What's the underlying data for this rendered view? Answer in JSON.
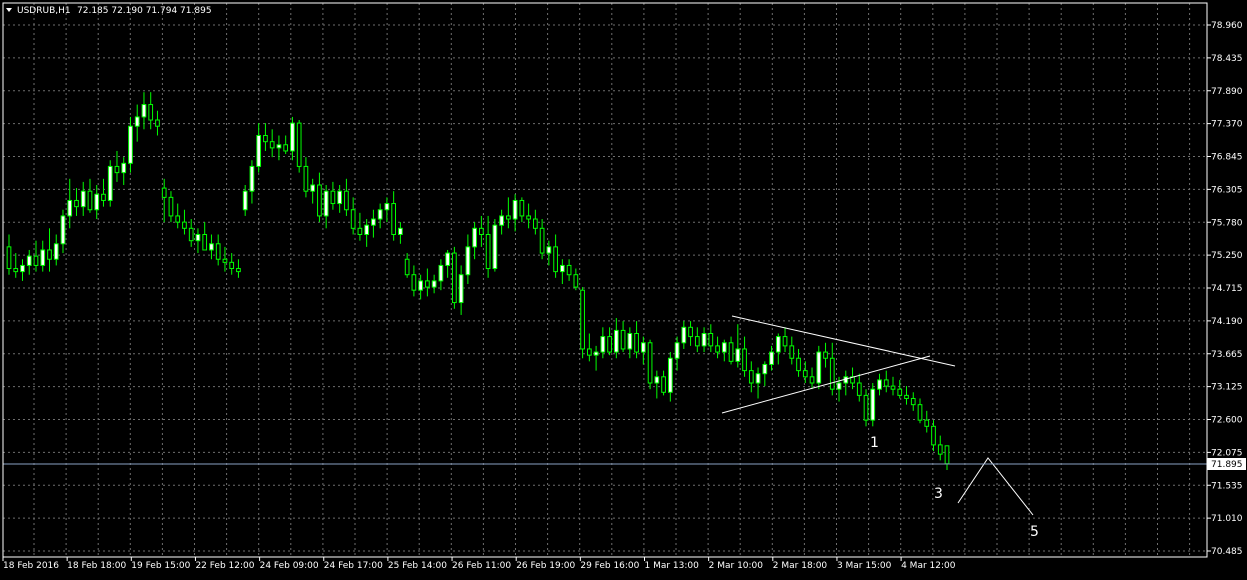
{
  "header": {
    "symbol": "USDRUB,H1",
    "ohlc": "72.185 72.190 71.794 71.895"
  },
  "current_price_label": "71.895",
  "colors": {
    "background": "#000000",
    "grid": "#6e6e6e",
    "frame": "#ffffff",
    "bull_body": "#ffffff",
    "bear_body": "#000000",
    "candle_wick": "#00ff00",
    "price_line": "#8aa2c4",
    "trendline": "#ffffff"
  },
  "chart_data": {
    "type": "candlestick",
    "ylim": [
      70.485,
      79.228
    ],
    "y_ticks": [
      "78.960",
      "78.435",
      "77.890",
      "77.370",
      "76.845",
      "76.305",
      "75.780",
      "75.250",
      "74.715",
      "74.190",
      "73.665",
      "73.125",
      "72.600",
      "72.075",
      "71.535",
      "71.010",
      "70.485"
    ],
    "x_ticks": [
      "18 Feb 2016",
      "18 Feb 18:00",
      "19 Feb 15:00",
      "22 Feb 12:00",
      "24 Feb 09:00",
      "24 Feb 17:00",
      "25 Feb 14:00",
      "26 Feb 11:00",
      "26 Feb 19:00",
      "29 Feb 16:00",
      "1 Mar 13:00",
      "2 Mar 10:00",
      "2 Mar 18:00",
      "3 Mar 15:00",
      "4 Mar 12:00"
    ],
    "grid": true,
    "last_price": 71.895,
    "candles": [
      [
        75.4,
        75.6,
        74.95,
        75.05
      ],
      [
        75.05,
        75.3,
        74.9,
        75.0
      ],
      [
        75.0,
        75.2,
        74.85,
        75.1
      ],
      [
        75.1,
        75.35,
        74.95,
        75.25
      ],
      [
        75.25,
        75.5,
        75.0,
        75.1
      ],
      [
        75.1,
        75.5,
        75.0,
        75.35
      ],
      [
        75.35,
        75.7,
        75.0,
        75.2
      ],
      [
        75.2,
        75.6,
        75.1,
        75.45
      ],
      [
        75.45,
        76.0,
        75.3,
        75.9
      ],
      [
        75.9,
        76.5,
        75.7,
        76.15
      ],
      [
        76.15,
        76.35,
        75.9,
        76.05
      ],
      [
        76.05,
        76.45,
        75.9,
        76.3
      ],
      [
        76.3,
        76.5,
        75.95,
        76.0
      ],
      [
        76.0,
        76.4,
        75.85,
        76.25
      ],
      [
        76.25,
        76.5,
        76.05,
        76.15
      ],
      [
        76.15,
        76.8,
        76.05,
        76.7
      ],
      [
        76.7,
        76.95,
        76.45,
        76.6
      ],
      [
        76.6,
        76.85,
        76.4,
        76.75
      ],
      [
        76.75,
        77.5,
        76.6,
        77.35
      ],
      [
        77.35,
        77.7,
        77.1,
        77.5
      ],
      [
        77.5,
        77.9,
        77.3,
        77.7
      ],
      [
        77.7,
        77.9,
        77.3,
        77.45
      ],
      [
        77.45,
        77.6,
        77.2,
        77.35
      ],
      [
        76.35,
        76.5,
        75.8,
        76.2
      ],
      [
        76.2,
        76.3,
        75.8,
        75.9
      ],
      [
        75.9,
        76.1,
        75.7,
        75.8
      ],
      [
        75.8,
        76.0,
        75.6,
        75.7
      ],
      [
        75.7,
        75.85,
        75.4,
        75.5
      ],
      [
        75.5,
        75.7,
        75.3,
        75.6
      ],
      [
        75.6,
        75.8,
        75.4,
        75.35
      ],
      [
        75.35,
        75.6,
        75.2,
        75.45
      ],
      [
        75.45,
        75.6,
        75.1,
        75.2
      ],
      [
        75.2,
        75.4,
        75.0,
        75.15
      ],
      [
        75.15,
        75.3,
        74.95,
        75.05
      ],
      [
        75.05,
        75.2,
        74.9,
        75.0
      ],
      [
        76.0,
        76.4,
        75.9,
        76.3
      ],
      [
        76.3,
        76.8,
        76.1,
        76.7
      ],
      [
        76.7,
        77.4,
        76.6,
        77.2
      ],
      [
        77.2,
        77.4,
        76.95,
        77.1
      ],
      [
        77.1,
        77.3,
        76.85,
        77.0
      ],
      [
        77.0,
        77.2,
        76.8,
        77.05
      ],
      [
        77.05,
        77.2,
        76.9,
        76.95
      ],
      [
        76.95,
        77.5,
        76.8,
        77.4
      ],
      [
        77.4,
        77.45,
        76.6,
        76.7
      ],
      [
        76.7,
        76.85,
        76.2,
        76.3
      ],
      [
        76.3,
        76.5,
        76.1,
        76.4
      ],
      [
        76.4,
        76.6,
        75.8,
        75.9
      ],
      [
        75.9,
        76.4,
        75.7,
        76.3
      ],
      [
        76.3,
        76.45,
        76.0,
        76.1
      ],
      [
        76.1,
        76.4,
        75.95,
        76.3
      ],
      [
        76.3,
        76.5,
        75.9,
        76.0
      ],
      [
        76.0,
        76.2,
        75.6,
        75.7
      ],
      [
        75.7,
        75.95,
        75.5,
        75.6
      ],
      [
        75.6,
        75.85,
        75.4,
        75.75
      ],
      [
        75.75,
        76.0,
        75.55,
        75.85
      ],
      [
        75.85,
        76.1,
        75.7,
        76.0
      ],
      [
        76.0,
        76.2,
        75.8,
        76.1
      ],
      [
        76.1,
        76.3,
        75.5,
        75.6
      ],
      [
        75.6,
        75.8,
        75.45,
        75.7
      ],
      [
        75.2,
        75.3,
        74.9,
        74.95
      ],
      [
        74.95,
        75.1,
        74.6,
        74.7
      ],
      [
        74.7,
        74.95,
        74.55,
        74.85
      ],
      [
        74.85,
        75.05,
        74.6,
        74.75
      ],
      [
        74.75,
        74.95,
        74.65,
        74.85
      ],
      [
        74.85,
        75.2,
        74.7,
        75.1
      ],
      [
        75.1,
        75.35,
        74.9,
        75.3
      ],
      [
        75.3,
        75.4,
        74.4,
        74.5
      ],
      [
        74.5,
        75.1,
        74.3,
        74.95
      ],
      [
        74.95,
        75.6,
        74.8,
        75.4
      ],
      [
        75.4,
        75.8,
        75.2,
        75.7
      ],
      [
        75.7,
        75.9,
        75.4,
        75.6
      ],
      [
        75.6,
        75.9,
        74.9,
        75.05
      ],
      [
        75.05,
        75.85,
        75.0,
        75.75
      ],
      [
        75.75,
        76.0,
        75.6,
        75.9
      ],
      [
        75.9,
        76.2,
        75.7,
        75.85
      ],
      [
        75.85,
        76.25,
        75.65,
        76.15
      ],
      [
        76.15,
        76.2,
        75.8,
        75.9
      ],
      [
        75.9,
        76.1,
        75.7,
        75.85
      ],
      [
        75.85,
        76.0,
        75.6,
        75.7
      ],
      [
        75.7,
        75.85,
        75.2,
        75.3
      ],
      [
        75.3,
        75.5,
        75.1,
        75.4
      ],
      [
        75.4,
        75.6,
        74.9,
        75.0
      ],
      [
        75.0,
        75.2,
        74.8,
        75.1
      ],
      [
        75.1,
        75.2,
        74.85,
        74.95
      ],
      [
        74.95,
        75.05,
        74.7,
        74.75
      ],
      [
        74.7,
        74.75,
        73.6,
        73.75
      ],
      [
        73.75,
        74.0,
        73.55,
        73.65
      ],
      [
        73.65,
        73.8,
        73.4,
        73.7
      ],
      [
        73.7,
        74.1,
        73.6,
        73.95
      ],
      [
        73.95,
        74.1,
        73.65,
        73.7
      ],
      [
        73.7,
        74.25,
        73.6,
        74.05
      ],
      [
        74.05,
        74.2,
        73.7,
        73.75
      ],
      [
        73.75,
        74.1,
        73.6,
        74.0
      ],
      [
        74.0,
        74.2,
        73.6,
        73.7
      ],
      [
        73.7,
        73.95,
        73.5,
        73.85
      ],
      [
        73.85,
        73.9,
        73.1,
        73.2
      ],
      [
        73.2,
        73.4,
        72.95,
        73.3
      ],
      [
        73.3,
        73.4,
        73.0,
        73.05
      ],
      [
        73.05,
        73.7,
        72.9,
        73.6
      ],
      [
        73.6,
        73.95,
        73.4,
        73.85
      ],
      [
        73.85,
        74.2,
        73.75,
        74.1
      ],
      [
        74.1,
        74.2,
        73.8,
        73.95
      ],
      [
        73.95,
        74.1,
        73.7,
        73.8
      ],
      [
        73.8,
        74.1,
        73.7,
        74.0
      ],
      [
        74.0,
        74.15,
        73.7,
        73.8
      ],
      [
        73.8,
        73.95,
        73.6,
        73.7
      ],
      [
        73.7,
        73.9,
        73.55,
        73.85
      ],
      [
        73.85,
        73.95,
        73.5,
        73.55
      ],
      [
        73.55,
        74.15,
        73.45,
        73.75
      ],
      [
        73.75,
        73.95,
        73.3,
        73.4
      ],
      [
        73.4,
        73.55,
        73.05,
        73.2
      ],
      [
        73.2,
        73.45,
        72.95,
        73.35
      ],
      [
        73.35,
        73.55,
        73.15,
        73.5
      ],
      [
        73.5,
        73.8,
        73.4,
        73.7
      ],
      [
        73.7,
        74.0,
        73.5,
        73.95
      ],
      [
        73.95,
        74.1,
        73.7,
        73.8
      ],
      [
        73.8,
        73.95,
        73.5,
        73.6
      ],
      [
        73.6,
        73.75,
        73.3,
        73.4
      ],
      [
        73.4,
        73.55,
        73.2,
        73.3
      ],
      [
        73.3,
        73.45,
        73.1,
        73.2
      ],
      [
        73.2,
        73.8,
        73.1,
        73.7
      ],
      [
        73.7,
        73.85,
        73.45,
        73.6
      ],
      [
        73.6,
        73.85,
        73.0,
        73.1
      ],
      [
        73.1,
        73.3,
        72.9,
        73.2
      ],
      [
        73.2,
        73.4,
        73.0,
        73.3
      ],
      [
        73.3,
        73.45,
        73.1,
        73.2
      ],
      [
        73.2,
        73.35,
        72.9,
        73.0
      ],
      [
        73.0,
        73.1,
        72.5,
        72.6
      ],
      [
        72.6,
        73.2,
        72.5,
        73.1
      ],
      [
        73.1,
        73.35,
        73.0,
        73.25
      ],
      [
        73.25,
        73.4,
        73.05,
        73.15
      ],
      [
        73.15,
        73.3,
        73.0,
        73.1
      ],
      [
        73.1,
        73.25,
        72.95,
        73.0
      ],
      [
        73.0,
        73.15,
        72.85,
        72.95
      ],
      [
        72.95,
        73.05,
        72.75,
        72.85
      ],
      [
        72.85,
        72.95,
        72.55,
        72.6
      ],
      [
        72.6,
        72.75,
        72.4,
        72.5
      ],
      [
        72.5,
        72.6,
        72.1,
        72.2
      ],
      [
        72.2,
        72.35,
        71.95,
        72.05
      ],
      [
        72.185,
        72.19,
        71.794,
        71.895
      ]
    ]
  },
  "annotations": {
    "wave_1": "1",
    "wave_3": "3",
    "wave_5": "5"
  }
}
